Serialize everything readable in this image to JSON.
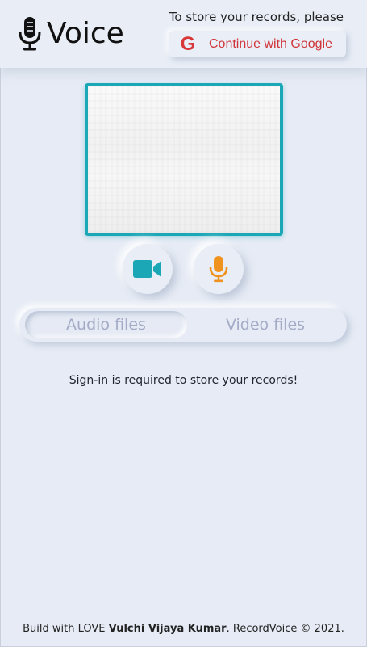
{
  "header": {
    "app_name": "Voice",
    "store_hint": "To store your records, please",
    "google_button": {
      "icon_letter": "G",
      "label": "Continue with Google"
    }
  },
  "icons": {
    "logo": "microphone-icon",
    "video": "video-camera-icon",
    "audio": "microphone-icon"
  },
  "colors": {
    "accent": "#1ba7b6",
    "mic": "#f0931e",
    "google_red": "#d13438",
    "background": "#e6ebf5"
  },
  "tabs": [
    {
      "label": "Audio files",
      "selected": true
    },
    {
      "label": "Video files",
      "selected": false
    }
  ],
  "message": "Sign-in is required to store your records!",
  "footer": {
    "prefix": "Build with LOVE ",
    "author": "Vulchi Vijaya Kumar",
    "suffix": ". RecordVoice © 2021."
  }
}
